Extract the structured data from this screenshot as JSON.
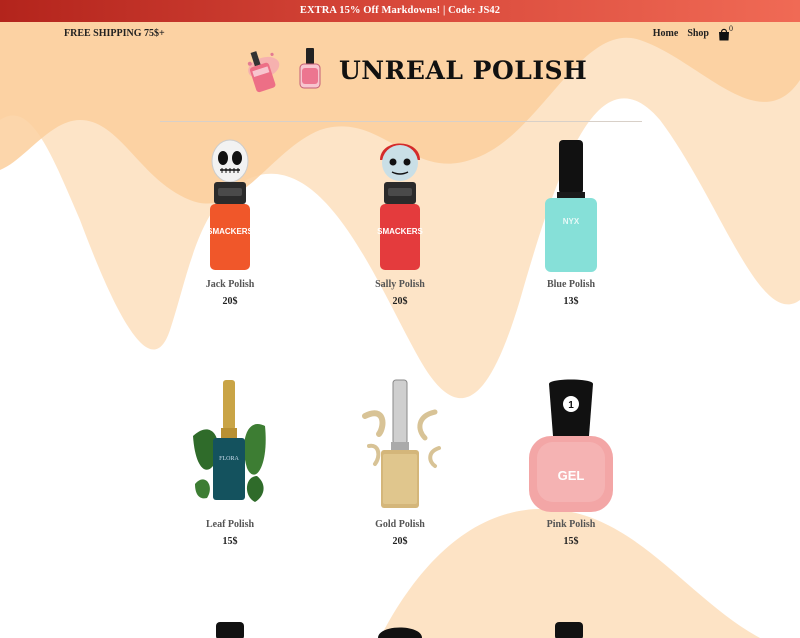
{
  "promo": {
    "text": "EXTRA 15% Off Markdowns! | Code: JS42"
  },
  "nav": {
    "shipping": "FREE SHIPPING 75$+",
    "home": "Home",
    "shop": "Shop",
    "cart_count": "0"
  },
  "brand": {
    "title": "UNREAL POLISH"
  },
  "products": [
    {
      "name": "Jack Polish",
      "price": "20$"
    },
    {
      "name": "Sally Polish",
      "price": "20$"
    },
    {
      "name": "Blue Polish",
      "price": "13$"
    },
    {
      "name": "Leaf Polish",
      "price": "15$"
    },
    {
      "name": "Gold Polish",
      "price": "20$"
    },
    {
      "name": "Pink Polish",
      "price": "15$"
    }
  ],
  "colors": {
    "promo_start": "#b3241c",
    "promo_end": "#f06a55",
    "wave_peach": "#fcd9b3"
  }
}
